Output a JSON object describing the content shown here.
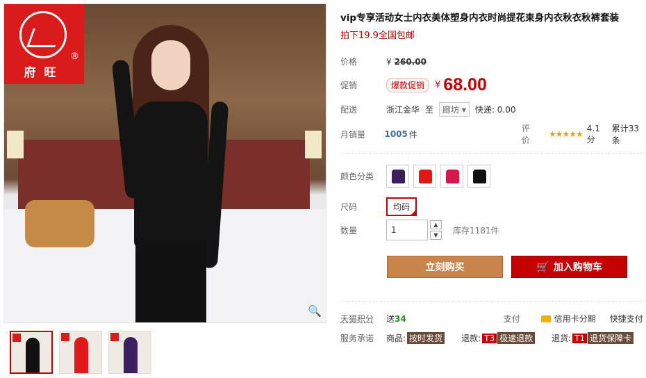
{
  "brand": {
    "logo_text": "府旺",
    "reg_mark": "®",
    "color": "#d91b1b"
  },
  "product": {
    "title": "vip专享活动女士内衣美体塑身内衣时尚提花束身内衣秋衣秋裤套装",
    "subtitle": "拍下19.9全国包邮"
  },
  "price": {
    "label": "价格",
    "currency": "¥",
    "original": "260.00"
  },
  "promo": {
    "label": "促销",
    "badge": "爆款促销",
    "currency": "¥",
    "price": "68.00"
  },
  "shipping": {
    "label": "配送",
    "from": "浙江金华",
    "to_word": "至",
    "destination": "廊坊",
    "fee": "快递: 0.00"
  },
  "sales": {
    "label": "月销量",
    "count": "1005",
    "unit": "件",
    "rating_label": "评价",
    "stars": "★★★★★",
    "score": "4.1分",
    "reviews": "累计33条"
  },
  "options": {
    "color_label": "颜色分类",
    "swatches": [
      {
        "name": "purple",
        "color": "#3b1f5e"
      },
      {
        "name": "red",
        "color": "#e01818"
      },
      {
        "name": "rose",
        "color": "#d8184a"
      },
      {
        "name": "black",
        "color": "#111111"
      }
    ],
    "size_label": "尺码",
    "size_value": "均码"
  },
  "quantity": {
    "label": "数量",
    "value": "1",
    "stock": "库存1181件",
    "up": "▲",
    "down": "▼"
  },
  "buttons": {
    "buy": "立刻购买",
    "cart": "加入购物车",
    "cart_icon": "🛒"
  },
  "points": {
    "label": "天猫积分",
    "send": "送",
    "value": "34",
    "pay_label": "支付",
    "credit": "信用卡分期",
    "quick_pay": "快捷支付"
  },
  "service": {
    "label": "服务承诺",
    "goods": "商品:",
    "goods_tag": "按时发货",
    "refund": "退款:",
    "refund_code": "T3",
    "refund_tag": "极速退款",
    "return": "退货:",
    "return_code": "T1",
    "return_tag": "退货保障卡"
  },
  "zoom_icon": "🔍"
}
